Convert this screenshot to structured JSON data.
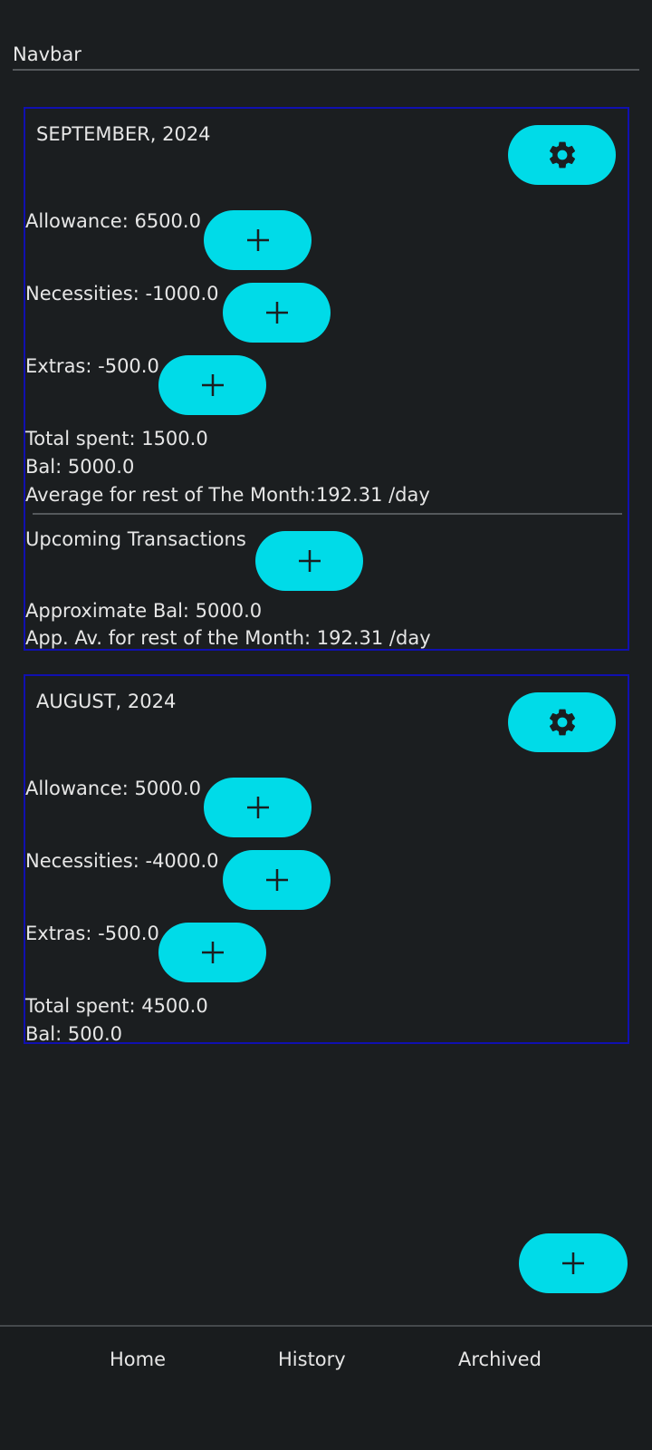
{
  "navbar": {
    "title": "Navbar"
  },
  "colors": {
    "accent": "#00dbe8",
    "card_border": "#1010b0",
    "background": "#1b1e20"
  },
  "months": [
    {
      "title": "SEPTEMBER, 2024",
      "settings_icon": "gear-icon",
      "allowance": "Allowance: 6500.0",
      "necessities": "Necessities: -1000.0",
      "extras": "Extras: -500.0",
      "total_spent": "Total spent: 1500.0",
      "balance": "Bal: 5000.0",
      "average": "Average for rest of The Month:192.31 /day",
      "upcoming_label": "Upcoming Transactions",
      "approx_balance": "Approximate Bal: 5000.0",
      "approx_average": "App. Av. for rest of the Month: 192.31 /day"
    },
    {
      "title": "AUGUST, 2024",
      "settings_icon": "gear-icon",
      "allowance": "Allowance: 5000.0",
      "necessities": "Necessities: -4000.0",
      "extras": "Extras: -500.0",
      "total_spent": "Total spent: 4500.0",
      "balance": "Bal: 500.0"
    }
  ],
  "fab": {
    "icon": "plus-icon"
  },
  "bottom_nav": {
    "items": [
      {
        "label": "Home"
      },
      {
        "label": "History"
      },
      {
        "label": "Archived"
      }
    ]
  }
}
